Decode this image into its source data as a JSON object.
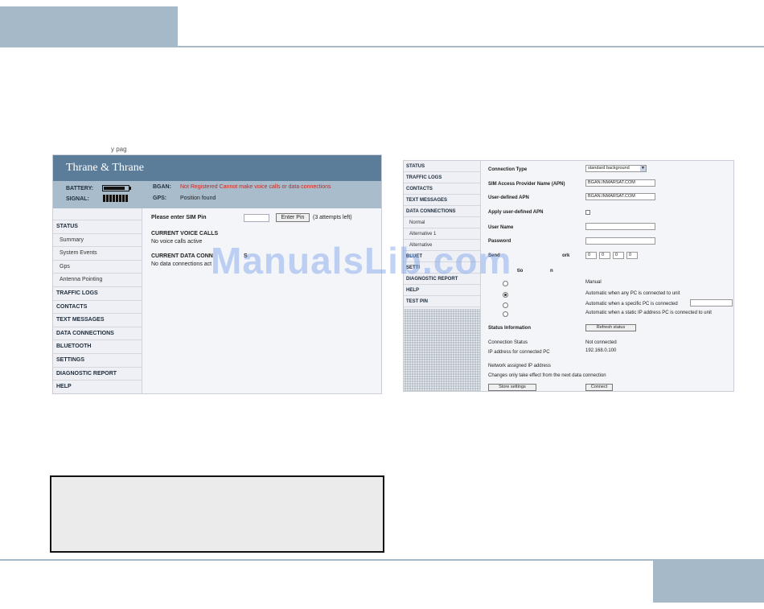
{
  "page": {
    "cut_text": "y pag"
  },
  "left_screenshot": {
    "logo": "Thrane & Thrane",
    "status_bar": {
      "battery_label": "BATTERY:",
      "battery_level": 0.9,
      "signal_label": "SIGNAL:",
      "signal_bars": 8,
      "bgan_label": "BGAN:",
      "bgan_value": "Not Registered Cannot make voice calls or data connections",
      "gps_label": "GPS:",
      "gps_value": "Position found"
    },
    "nav": [
      {
        "label": "STATUS",
        "sub": false
      },
      {
        "label": "Summary",
        "sub": true
      },
      {
        "label": "System Events",
        "sub": true
      },
      {
        "label": "Gps",
        "sub": true
      },
      {
        "label": "Antenna Pointing",
        "sub": true
      },
      {
        "label": "TRAFFIC LOGS",
        "sub": false
      },
      {
        "label": "CONTACTS",
        "sub": false
      },
      {
        "label": "TEXT MESSAGES",
        "sub": false
      },
      {
        "label": "DATA CONNECTIONS",
        "sub": false
      },
      {
        "label": "BLUETOOTH",
        "sub": false
      },
      {
        "label": "SETTINGS",
        "sub": false
      },
      {
        "label": "DIAGNOSTIC REPORT",
        "sub": false
      },
      {
        "label": "HELP",
        "sub": false
      }
    ],
    "main": {
      "pin_prompt": "Please enter SIM Pin",
      "pin_button": "Enter Pin",
      "attempts": "(3 attempts left)",
      "voice_heading": "CURRENT VOICE CALLS",
      "voice_value": "No voice calls active",
      "data_heading": "CURRENT DATA CONN",
      "data_heading_tail": "S",
      "data_value": "No data connections act"
    }
  },
  "right_screenshot": {
    "nav": [
      {
        "label": "STATUS",
        "sub": false
      },
      {
        "label": "TRAFFIC LOGS",
        "sub": false
      },
      {
        "label": "CONTACTS",
        "sub": false
      },
      {
        "label": "TEXT MESSAGES",
        "sub": false
      },
      {
        "label": "DATA CONNECTIONS",
        "sub": false
      },
      {
        "label": "Normal",
        "sub": true
      },
      {
        "label": "Alternative 1",
        "sub": true
      },
      {
        "label": "Alternative",
        "sub": true
      },
      {
        "label": "BLUET",
        "sub": false
      },
      {
        "label": "SETTI",
        "sub": false
      },
      {
        "label": "DIAGNOSTIC REPORT",
        "sub": false
      },
      {
        "label": "HELP",
        "sub": false
      },
      {
        "label": "TEST PIN",
        "sub": false
      }
    ],
    "form": {
      "connection_type_label": "Connection Type",
      "connection_type_value": "standard background",
      "apn_label": "SIM Access Provider Name (APN)",
      "apn_value": "BGAN.INMARSAT.COM",
      "user_apn_label": "User-defined APN",
      "user_apn_value": "BGAN.INMARSAT.COM",
      "apply_apn_label": "Apply user-defined APN",
      "username_label": "User Name",
      "password_label": "Password",
      "dns_label": "Send",
      "dns_label_tail": "ork",
      "ip_parts": [
        "0",
        "0",
        "0",
        "0"
      ],
      "activation_label": "tio",
      "activation_label_tail": "n",
      "radio_options": [
        {
          "label": "Manual",
          "checked": false
        },
        {
          "label": "Automatic when any PC is connected to unit",
          "checked": true
        },
        {
          "label": "Automatic when a specific PC is connected",
          "checked": false
        },
        {
          "label": "Automatic when a static IP address PC is connected to unit",
          "checked": false
        }
      ],
      "status_info_label": "Status Information",
      "refresh_button": "Refresh status",
      "connection_status_label": "Connection Status",
      "connection_status_value": "Not connected",
      "ip_pc_label": "IP address for connected PC",
      "ip_pc_value": "192.168.0.100",
      "network_ip_label": "Network assigned IP address",
      "changes_note": "Changes only take effect from the next data connection",
      "store_button": "Store settings",
      "connect_button": "Connect"
    }
  },
  "watermark": "ManualsLib.com"
}
